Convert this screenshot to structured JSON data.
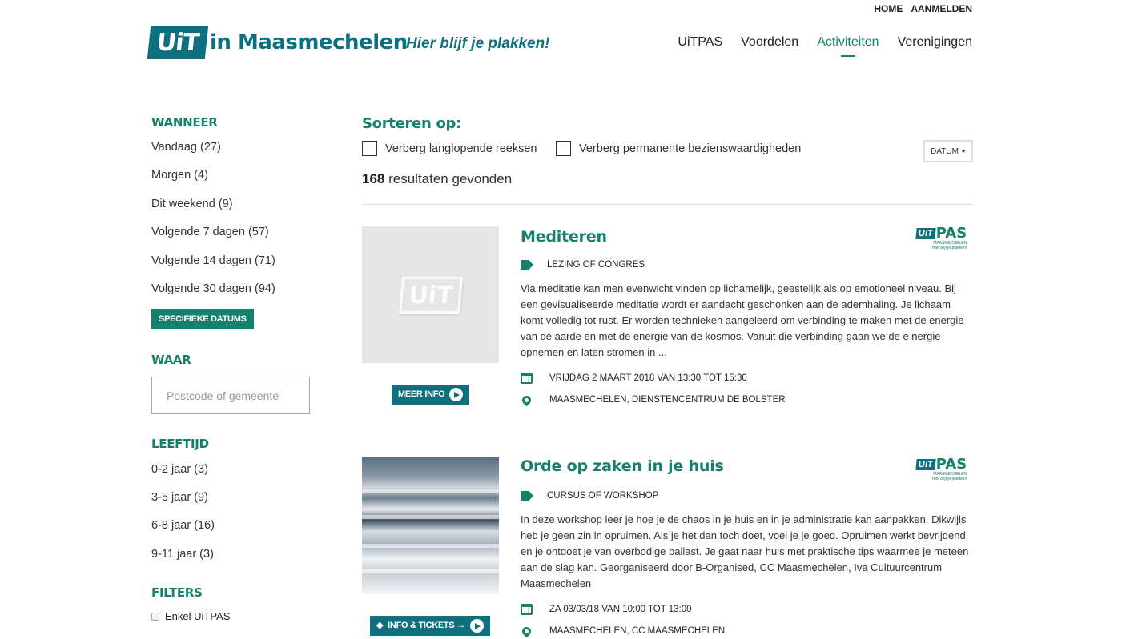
{
  "header": {
    "top_links": [
      "HOME",
      "AANMELDEN"
    ],
    "logo_mark": "UiT",
    "logo_text": "in Maasmechelen",
    "slogan": "Hier blijf je plakken!",
    "nav": [
      "UiTPAS",
      "Voordelen",
      "Activiteiten",
      "Verenigingen"
    ],
    "active_nav": "Activiteiten"
  },
  "sidebar": {
    "wanneer": {
      "title": "WANNEER",
      "items": [
        "Vandaag (27)",
        "Morgen (4)",
        "Dit weekend (9)",
        "Volgende 7 dagen (57)",
        "Volgende 14 dagen (71)",
        "Volgende 30 dagen (94)"
      ],
      "button": "SPECIFIEKE DATUMS"
    },
    "waar": {
      "title": "WAAR",
      "placeholder": "Postcode of gemeente"
    },
    "leeftijd": {
      "title": "LEEFTIJD",
      "items": [
        "0-2 jaar (3)",
        "3-5 jaar (9)",
        "6-8 jaar (16)",
        "9-11 jaar (3)"
      ]
    },
    "filters": {
      "title": "FILTERS",
      "items": [
        "Enkel UiTPAS"
      ]
    }
  },
  "main": {
    "sort_title": "Sorteren op:",
    "checkboxes": [
      "Verberg langlopende reeksen",
      "Verberg permanente bezienswaardigheden"
    ],
    "sort_select": "DATUM",
    "results_count": "168",
    "results_label": "resultaten gevonden",
    "events": [
      {
        "title": "Mediteren",
        "category": "LEZING OF CONGRES",
        "description": "Via meditatie kan men evenwicht vinden op lichamelijk, geestelijk als op emotioneel niveau. Bij een gevisualiseerde meditatie wordt er aandacht geschonken aan de ademhaling. Je lichaam komt volledig tot rust. Er worden technieken aangeleerd om verbinding te maken met de energie van de aarde en met de energie van de kosmos. Vanuit die verbinding gaan we de e nergie opnemen en laten stromen in ...",
        "date": "VRIJDAG 2 MAART 2018 VAN 13:30 TOT 15:30",
        "location": "MAASMECHELEN, DIENSTENCENTRUM DE BOLSTER",
        "button": "MEER INFO",
        "image": "placeholder-uit-logo",
        "badge": "UiTPAS"
      },
      {
        "title": "Orde op zaken in je huis",
        "category": "CURSUS OF WORKSHOP",
        "description": "In deze workshop leer je hoe je de chaos in je huis en in je administratie kan aanpakken. Dikwijls heb je geen zin in opruimen. Als je het dan toch doet, voel je je goed. Opruimen werkt bevrijdend en je ontdoet je van overbodige ballast. Je gaat naar huis met praktische tips waarmee je meteen aan de slag kan. Georganiseerd door B-Organised, CC Maasmechelen, Iva Cultuurcentrum Maasmechelen",
        "date": "ZA 03/03/18 VAN 10:00 TOT 13:00",
        "location": "MAASMECHELEN, CC MAASMECHELEN",
        "button": "INFO & TICKETS →",
        "image": "photo-stacked-papers",
        "badge": "UiTPAS"
      }
    ]
  },
  "badge": {
    "line1": "UiT",
    "line2": "PAS",
    "line3": "MAASMECHELEN",
    "line4": "Hier blijf je plakken!"
  },
  "icons": [
    "tag-icon",
    "calendar-icon",
    "map-pin-icon",
    "play-icon",
    "caret-down-icon",
    "ticket-icon"
  ],
  "colors": {
    "brand_teal": "#0e6f7f",
    "brand_green": "#16806a"
  }
}
